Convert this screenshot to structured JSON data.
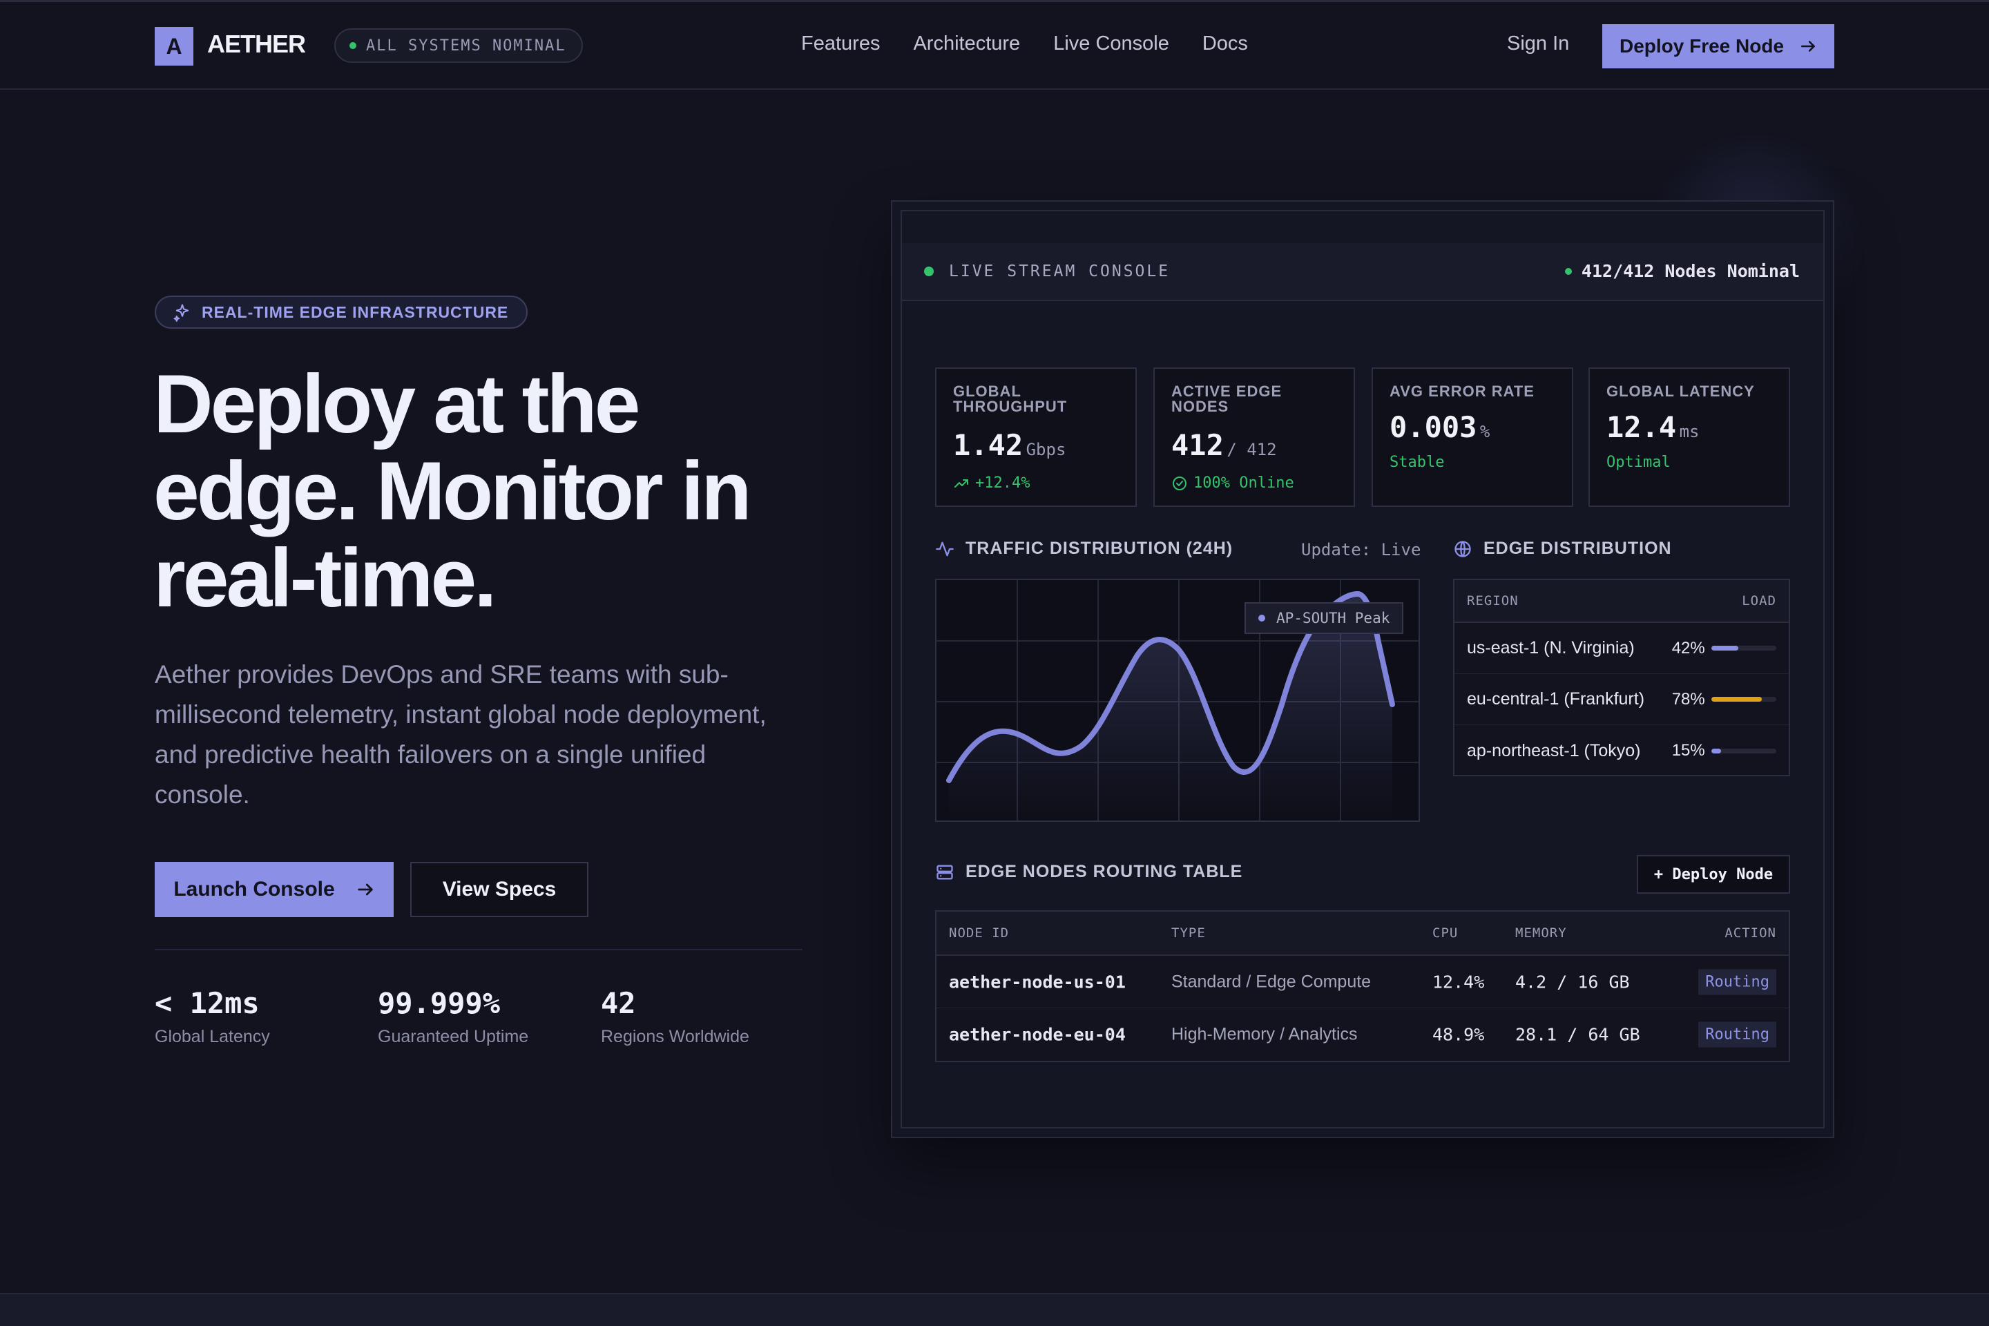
{
  "nav": {
    "logo_letter": "A",
    "brand": "AETHER",
    "status": "ALL SYSTEMS NOMINAL",
    "links": [
      "Features",
      "Architecture",
      "Live Console",
      "Docs"
    ],
    "sign_in": "Sign In",
    "deploy_cta": "Deploy Free Node"
  },
  "hero": {
    "badge": "REAL-TIME EDGE INFRASTRUCTURE",
    "title_lines": [
      "Deploy at the",
      "edge. Monitor in",
      "real-time."
    ],
    "description_lines": [
      "Aether provides DevOps and SRE teams with sub-",
      "millisecond telemetry, instant global node deployment,",
      "and predictive health failovers on a single unified",
      "console."
    ],
    "primary_cta": "Launch Console",
    "secondary_cta": "View Specs",
    "stats": [
      {
        "value": "< 12ms",
        "label": "Global Latency"
      },
      {
        "value": "99.999%",
        "label": "Guaranteed Uptime"
      },
      {
        "value": "42",
        "label": "Regions Worldwide"
      }
    ]
  },
  "console": {
    "label": "LIVE STREAM CONSOLE",
    "nodes_status": "412/412 Nodes Nominal",
    "metrics": [
      {
        "title_lines": [
          "GLOBAL",
          "THROUGHPUT"
        ],
        "value": "1.42",
        "unit": "Gbps",
        "sub": "+12.4%",
        "sub_icon": "trending-up-icon"
      },
      {
        "title_lines": [
          "ACTIVE EDGE",
          "NODES"
        ],
        "value": "412",
        "unit": "/ 412",
        "sub": "100% Online",
        "sub_icon": "check-circle-icon"
      },
      {
        "title_lines": [
          "AVG ERROR RATE"
        ],
        "value": "0.003",
        "unit": "%",
        "sub": "Stable",
        "sub_icon": ""
      },
      {
        "title_lines": [
          "GLOBAL LATENCY"
        ],
        "value": "12.4",
        "unit": "ms",
        "sub": "Optimal",
        "sub_icon": ""
      }
    ],
    "traffic": {
      "title": "TRAFFIC DISTRIBUTION (24H)",
      "update": "Update: Live",
      "peak_label": "AP-SOUTH Peak"
    },
    "edge_distribution": {
      "title": "EDGE DISTRIBUTION",
      "columns": [
        "REGION",
        "LOAD"
      ],
      "rows": [
        {
          "region": "us-east-1 (N. Virginia)",
          "load_label": "42%",
          "load": 0.42,
          "color": "#8b8fe6"
        },
        {
          "region": "eu-central-1 (Frankfurt)",
          "load_label": "78%",
          "load": 0.78,
          "color": "#e0a019"
        },
        {
          "region": "ap-northeast-1 (Tokyo)",
          "load_label": "15%",
          "load": 0.15,
          "color": "#8b8fe6"
        }
      ]
    },
    "routing_table": {
      "title": "EDGE NODES ROUTING TABLE",
      "deploy_button": "+ Deploy Node",
      "columns": [
        "NODE ID",
        "TYPE",
        "CPU",
        "MEMORY",
        "ACTION"
      ],
      "rows": [
        {
          "node_id": "aether-node-us-01",
          "type": "Standard / Edge Compute",
          "cpu": "12.4%",
          "memory": "4.2 / 16 GB",
          "action": "Routing"
        },
        {
          "node_id": "aether-node-eu-04",
          "type": "High-Memory / Analytics",
          "cpu": "48.9%",
          "memory": "28.1 / 64 GB",
          "action": "Routing"
        }
      ]
    }
  },
  "colors": {
    "accent": "#8b8fe6",
    "background": "#12131f",
    "success": "#34c36b",
    "warning": "#e0a019"
  }
}
